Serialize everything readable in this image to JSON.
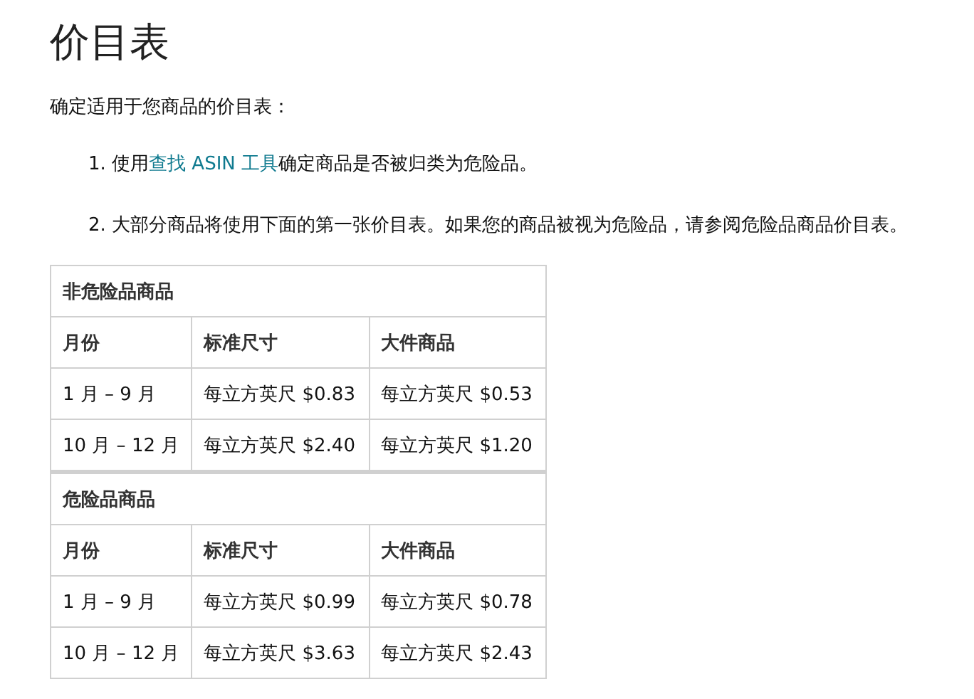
{
  "title": "价目表",
  "intro": "确定适用于您商品的价目表：",
  "steps": [
    {
      "number": "1.",
      "before": "使用",
      "link": "查找 ASIN 工具",
      "after": "确定商品是否被归类为危险品。"
    },
    {
      "number": "2.",
      "before": "大部分商品将使用下面的第一张价目表。如果您的商品被视为危险品，请参阅危险品商品价目表。"
    }
  ],
  "table": {
    "sections": [
      {
        "title": "非危险品商品",
        "columns": [
          "月份",
          "标准尺寸",
          "大件商品"
        ],
        "rows": [
          [
            "1 月 – 9 月",
            "每立方英尺 $0.83",
            "每立方英尺 $0.53"
          ],
          [
            "10 月 – 12 月",
            "每立方英尺 $2.40",
            "每立方英尺 $1.20"
          ]
        ]
      },
      {
        "title": "危险品商品",
        "columns": [
          "月份",
          "标准尺寸",
          "大件商品"
        ],
        "rows": [
          [
            "1 月 – 9 月",
            "每立方英尺 $0.99",
            "每立方英尺 $0.78"
          ],
          [
            "10 月 – 12 月",
            "每立方英尺 $3.63",
            "每立方英尺 $2.43"
          ]
        ]
      }
    ]
  }
}
